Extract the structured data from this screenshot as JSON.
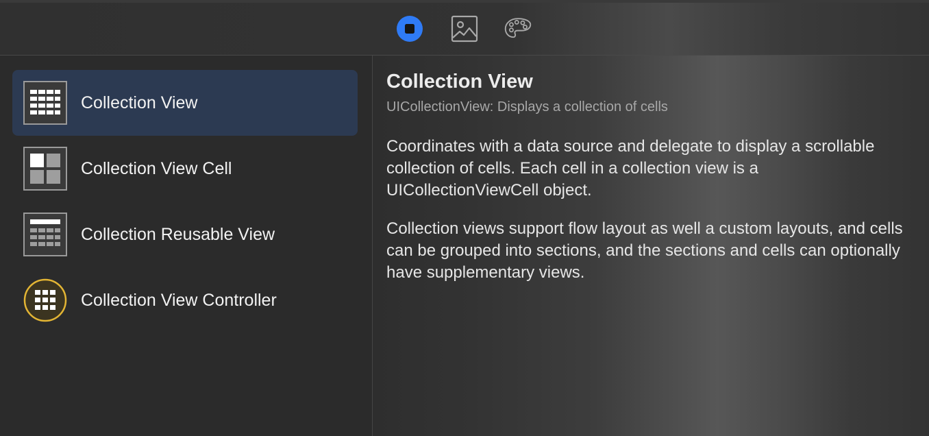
{
  "toolbar": {
    "tabs": [
      {
        "icon": "objects-library-icon",
        "selected": true
      },
      {
        "icon": "media-library-icon",
        "selected": false
      },
      {
        "icon": "color-palette-icon",
        "selected": false
      }
    ],
    "accent_color": "#2f7bf6"
  },
  "library": {
    "items": [
      {
        "label": "Collection View",
        "icon": "collection-view-icon",
        "selected": true
      },
      {
        "label": "Collection View Cell",
        "icon": "collection-view-cell-icon",
        "selected": false
      },
      {
        "label": "Collection Reusable View",
        "icon": "collection-reusable-view-icon",
        "selected": false
      },
      {
        "label": "Collection View Controller",
        "icon": "collection-view-controller-icon",
        "selected": false
      }
    ],
    "selected_bg": "#2c3a52"
  },
  "detail": {
    "title": "Collection View",
    "subtitle": "UICollectionView: Displays a collection of cells",
    "paragraph1": "Coordinates with a data source and delegate to display a scrollable collection of cells. Each cell in a collection view is a UICollectionViewCell object.",
    "paragraph2": "Collection views support flow layout as well a custom layouts, and cells can be grouped into sections, and the sections and cells can optionally have supplementary views."
  }
}
